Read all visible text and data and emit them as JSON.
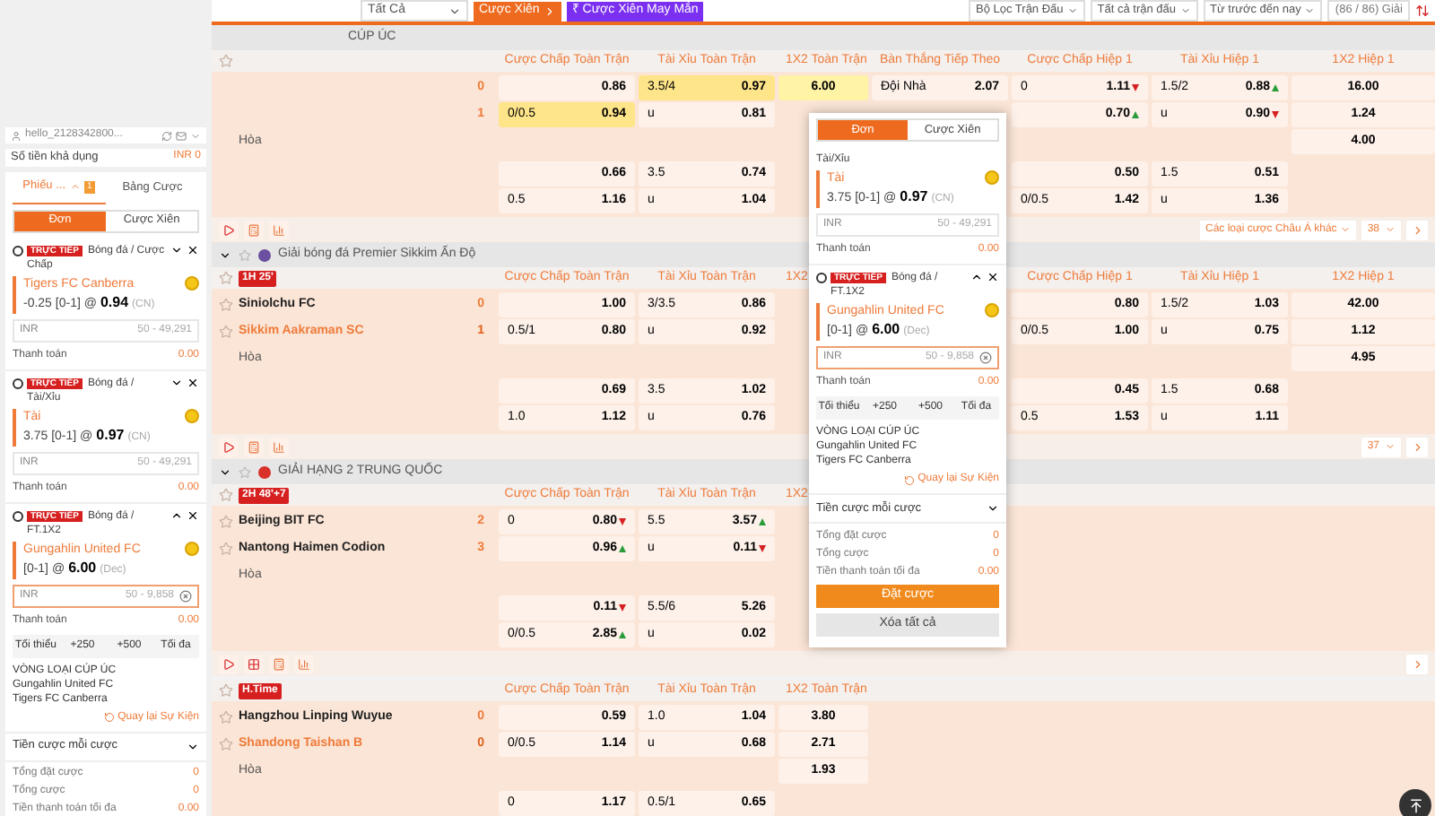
{
  "top_bar": {
    "filter": "Tất Cả",
    "parlay_button": "Cược Xiên",
    "lucky_button": "Cược Xiên May Mắn",
    "lucky_symbol": "₹",
    "dropdowns": [
      "Bộ Lọc Trận Đấu",
      "Tất cả trận đấu",
      "Từ trước đến nay"
    ],
    "league_count": "(86 / 86) Giải"
  },
  "leagues": [
    {
      "name": "CÚP ÚC",
      "matches": [
        {
          "columns": [
            "Cược Chấp Toàn Trận",
            "Tài Xỉu Toàn Trận",
            "1X2 Toàn Trận",
            "Bàn Thắng Tiếp Theo",
            "Cược Chấp Hiệp 1",
            "Tài Xỉu Hiệp 1",
            "1X2 Hiệp 1"
          ],
          "rows": [
            {
              "kind": "team",
              "score": "0",
              "highlighted": false,
              "cells": [
                {
                  "kind": "pair",
                  "odds": "0.86",
                  "selected": false
                },
                {
                  "kind": "pair",
                  "line": "3.5/4",
                  "odds": "0.97",
                  "selected": true
                },
                {
                  "kind": "single",
                  "odds": "6.00",
                  "selected": true
                },
                {
                  "kind": "pair",
                  "line": "Đội Nhà",
                  "odds": "2.07",
                  "selected": false
                },
                {
                  "kind": "pair",
                  "line": "0",
                  "odds": "1.11",
                  "rising": false,
                  "selected": false
                },
                {
                  "kind": "pair",
                  "line": "1.5/2",
                  "odds": "0.88",
                  "rising": true,
                  "selected": false
                },
                {
                  "kind": "single",
                  "odds": "16.00",
                  "selected": false
                }
              ]
            },
            {
              "kind": "team",
              "score": "1",
              "highlighted": false,
              "cells": [
                {
                  "kind": "pair",
                  "line": "0/0.5",
                  "odds": "0.94",
                  "selected": true
                },
                {
                  "kind": "pair",
                  "line": "u",
                  "odds": "0.81",
                  "selected": false
                },
                null,
                null,
                {
                  "kind": "pair",
                  "odds": "0.70",
                  "rising": true,
                  "selected": false
                },
                {
                  "kind": "pair",
                  "line": "u",
                  "odds": "0.90",
                  "rising": false,
                  "selected": false
                },
                {
                  "kind": "single",
                  "odds": "1.24",
                  "selected": false
                }
              ]
            },
            {
              "kind": "draw",
              "team": "Hòa",
              "cells": [
                null,
                null,
                null,
                null,
                null,
                null,
                {
                  "kind": "single",
                  "odds": "4.00",
                  "selected": false
                }
              ]
            },
            {
              "kind": "line",
              "cells": [
                {
                  "kind": "pair",
                  "odds": "0.66",
                  "selected": false
                },
                {
                  "kind": "pair",
                  "line": "3.5",
                  "odds": "0.74",
                  "selected": false
                },
                null,
                null,
                {
                  "kind": "pair",
                  "odds": "0.50",
                  "selected": false
                },
                {
                  "kind": "pair",
                  "line": "1.5",
                  "odds": "0.51",
                  "selected": false
                },
                null
              ]
            },
            {
              "kind": "line",
              "cells": [
                {
                  "kind": "pair",
                  "line": "0.5",
                  "odds": "1.16",
                  "selected": false
                },
                {
                  "kind": "pair",
                  "line": "u",
                  "odds": "1.04",
                  "selected": false
                },
                null,
                null,
                {
                  "kind": "pair",
                  "line": "0/0.5",
                  "odds": "1.42",
                  "selected": false
                },
                {
                  "kind": "pair",
                  "line": "u",
                  "odds": "1.36",
                  "selected": false
                },
                null
              ]
            }
          ],
          "footer": {
            "tools": [
              {
                "kind": "play"
              },
              {
                "kind": "calc"
              },
              {
                "kind": "stats"
              }
            ],
            "more": "Các loại cược Châu Á khác",
            "page": "38"
          }
        }
      ]
    },
    {
      "name": "Giải bóng đá Premier Sikkim Ấn Độ",
      "expanded": true,
      "color": "#6b4fa0",
      "matches": [
        {
          "time": "1H 25'",
          "columns": [
            "Cược Chấp Toàn Trận",
            "Tài Xỉu Toàn Trận",
            "1X2",
            null,
            "Cược Chấp Hiệp 1",
            "Tài Xỉu Hiệp 1",
            "1X2 Hiệp 1"
          ],
          "rows": [
            {
              "kind": "team",
              "team": "Siniolchu FC",
              "score": "0",
              "highlighted": false,
              "cells": [
                {
                  "kind": "pair",
                  "odds": "1.00",
                  "selected": false
                },
                {
                  "kind": "pair",
                  "line": "3/3.5",
                  "odds": "0.86",
                  "selected": false
                },
                null,
                null,
                {
                  "kind": "pair",
                  "odds": "0.80",
                  "selected": false
                },
                {
                  "kind": "pair",
                  "line": "1.5/2",
                  "odds": "1.03",
                  "selected": false
                },
                {
                  "kind": "single",
                  "odds": "42.00",
                  "selected": false
                }
              ]
            },
            {
              "kind": "team",
              "team": "Sikkim Aakraman SC",
              "score": "1",
              "highlighted": true,
              "cells": [
                {
                  "kind": "pair",
                  "line": "0.5/1",
                  "odds": "0.80",
                  "selected": false
                },
                {
                  "kind": "pair",
                  "line": "u",
                  "odds": "0.92",
                  "selected": false
                },
                null,
                null,
                {
                  "kind": "pair",
                  "line": "0/0.5",
                  "odds": "1.00",
                  "selected": false
                },
                {
                  "kind": "pair",
                  "line": "u",
                  "odds": "0.75",
                  "selected": false
                },
                {
                  "kind": "single",
                  "odds": "1.12",
                  "selected": false
                }
              ]
            },
            {
              "kind": "draw",
              "team": "Hòa",
              "cells": [
                null,
                null,
                null,
                null,
                null,
                null,
                {
                  "kind": "single",
                  "odds": "4.95",
                  "selected": false
                }
              ]
            },
            {
              "kind": "line",
              "cells": [
                {
                  "kind": "pair",
                  "odds": "0.69",
                  "selected": false
                },
                {
                  "kind": "pair",
                  "line": "3.5",
                  "odds": "1.02",
                  "selected": false
                },
                null,
                null,
                {
                  "kind": "pair",
                  "odds": "0.45",
                  "selected": false
                },
                {
                  "kind": "pair",
                  "line": "1.5",
                  "odds": "0.68",
                  "selected": false
                },
                null
              ]
            },
            {
              "kind": "line",
              "cells": [
                {
                  "kind": "pair",
                  "line": "1.0",
                  "odds": "1.12",
                  "selected": false
                },
                {
                  "kind": "pair",
                  "line": "u",
                  "odds": "0.76",
                  "selected": false
                },
                null,
                null,
                {
                  "kind": "pair",
                  "line": "0.5",
                  "odds": "1.53",
                  "selected": false
                },
                {
                  "kind": "pair",
                  "line": "u",
                  "odds": "1.11",
                  "selected": false
                },
                null
              ]
            }
          ],
          "footer": {
            "tools": [
              {
                "kind": "play"
              },
              {
                "kind": "calc"
              },
              {
                "kind": "stats"
              }
            ],
            "page": "37"
          }
        }
      ]
    },
    {
      "name": "GIẢI HẠNG 2 TRUNG QUỐC",
      "expanded": true,
      "color": "#d9302a",
      "matches": [
        {
          "time": "2H 48'+7",
          "columns": [
            "Cược Chấp Toàn Trận",
            "Tài Xỉu Toàn Trận",
            "1X2"
          ],
          "rows": [
            {
              "kind": "team",
              "team": "Beijing BIT FC",
              "score": "2",
              "highlighted": false,
              "cells": [
                {
                  "kind": "pair",
                  "line": "0",
                  "odds": "0.80",
                  "rising": false,
                  "selected": false
                },
                {
                  "kind": "pair",
                  "line": "5.5",
                  "odds": "3.57",
                  "rising": true,
                  "selected": false
                }
              ]
            },
            {
              "kind": "team",
              "team": "Nantong Haimen Codion",
              "score": "3",
              "highlighted": false,
              "cells": [
                {
                  "kind": "pair",
                  "odds": "0.96",
                  "rising": true,
                  "selected": false
                },
                {
                  "kind": "pair",
                  "line": "u",
                  "odds": "0.11",
                  "rising": false,
                  "selected": false
                }
              ]
            },
            {
              "kind": "draw",
              "team": "Hòa",
              "cells": [
                null,
                null
              ]
            },
            {
              "kind": "line",
              "cells": [
                {
                  "kind": "pair",
                  "odds": "0.11",
                  "rising": false,
                  "selected": false
                },
                {
                  "kind": "pair",
                  "line": "5.5/6",
                  "odds": "5.26",
                  "selected": false
                }
              ]
            },
            {
              "kind": "line",
              "cells": [
                {
                  "kind": "pair",
                  "line": "0/0.5",
                  "odds": "2.85",
                  "rising": true,
                  "selected": false
                },
                {
                  "kind": "pair",
                  "line": "u",
                  "odds": "0.02",
                  "selected": false
                }
              ]
            }
          ],
          "footer": {
            "tools": [
              {
                "kind": "play"
              },
              {
                "kind": "grid"
              },
              {
                "kind": "calc"
              },
              {
                "kind": "stats"
              }
            ]
          }
        },
        {
          "time": "H.Time",
          "columns": [
            "Cược Chấp Toàn Trận",
            "Tài Xỉu Toàn Trận",
            "1X2 Toàn Trận"
          ],
          "rows": [
            {
              "kind": "team",
              "team": "Hangzhou Linping Wuyue",
              "score": "0",
              "highlighted": false,
              "cells": [
                {
                  "kind": "pair",
                  "odds": "0.59",
                  "selected": false
                },
                {
                  "kind": "pair",
                  "line": "1.0",
                  "odds": "1.04",
                  "selected": false
                },
                {
                  "kind": "single",
                  "odds": "3.80",
                  "selected": false
                }
              ]
            },
            {
              "kind": "team",
              "team": "Shandong Taishan B",
              "score": "0",
              "highlighted": true,
              "cells": [
                {
                  "kind": "pair",
                  "line": "0/0.5",
                  "odds": "1.14",
                  "selected": false
                },
                {
                  "kind": "pair",
                  "line": "u",
                  "odds": "0.68",
                  "selected": false
                },
                {
                  "kind": "single",
                  "odds": "2.71",
                  "selected": false
                }
              ]
            },
            {
              "kind": "draw",
              "team": "Hòa",
              "cells": [
                null,
                null,
                {
                  "kind": "single",
                  "odds": "1.93",
                  "selected": false
                }
              ]
            },
            {
              "kind": "line",
              "cells": [
                {
                  "kind": "pair",
                  "line": "0",
                  "odds": "1.17",
                  "selected": false
                },
                {
                  "kind": "pair",
                  "line": "0.5/1",
                  "odds": "0.65",
                  "selected": false
                },
                null
              ]
            }
          ]
        }
      ]
    }
  ],
  "bet_slip": {
    "username": "hello_2128342800...",
    "balance": {
      "label": "Số tiền khả dụng",
      "value": "INR 0"
    },
    "tabs": [
      {
        "label": "Phiếu ...",
        "badge": "1",
        "selected": true
      },
      {
        "label": "Bảng Cược",
        "selected": false
      }
    ],
    "modes": [
      {
        "label": "Đơn",
        "selected": true
      },
      {
        "label": "Cược Xiên",
        "selected": false
      }
    ],
    "bets": [
      {
        "live_badge": "TRỰC TIẾP",
        "category": "Bóng đá / Cược Chấp",
        "selection": "Tigers FC Canberra",
        "line": "-0.25 [0-1] @",
        "odds": "0.94",
        "format": "(CN)",
        "currency": "INR",
        "placeholder": "50 - 49,291",
        "payout_label": "Thanh toán",
        "payout": "0.00",
        "expanded": false
      },
      {
        "live_badge": "TRỰC TIẾP",
        "category": "Bóng đá / Tài/Xỉu",
        "selection": "Tài",
        "line": "3.75 [0-1] @",
        "odds": "0.97",
        "format": "(CN)",
        "currency": "INR",
        "placeholder": "50 - 49,291",
        "payout_label": "Thanh toán",
        "payout": "0.00",
        "expanded": false
      },
      {
        "live_badge": "TRỰC TIẾP",
        "category": "Bóng đá / FT.1X2",
        "selection": "Gungahlin United FC",
        "line": "[0-1] @",
        "odds": "6.00",
        "format": "(Dec)",
        "currency": "INR",
        "placeholder": "50 - 9,858",
        "payout_label": "Thanh toán",
        "payout": "0.00",
        "expanded": true,
        "quick_amounts": [
          "Tối thiểu",
          "+250",
          "+500",
          "Tối đa"
        ],
        "event": [
          "VÒNG LOẠI CÚP ÚC",
          "Gungahlin United FC",
          "Tigers FC Canberra"
        ],
        "back_link": "Quay lại Sự Kiện"
      }
    ],
    "stake_option": "Tiền cược mỗi cược",
    "totals": [
      {
        "label": "Tổng đặt cược",
        "value": "0"
      },
      {
        "label": "Tổng cược",
        "value": "0"
      },
      {
        "label": "Tiền thanh toán tối đa",
        "value": "0.00"
      }
    ]
  },
  "bet_slip_popup": {
    "modes": [
      {
        "label": "Đơn",
        "selected": true
      },
      {
        "label": "Cược Xiên",
        "selected": false
      }
    ],
    "bets": [
      {
        "category": "Tài/Xỉu",
        "selection": "Tài",
        "line": "3.75 [0-1] @",
        "odds": "0.97",
        "format": "(CN)",
        "currency": "INR",
        "placeholder": "50 - 49,291",
        "payout_label": "Thanh toán",
        "payout": "0.00",
        "expanded": false
      },
      {
        "live_badge": "TRỰC TIẾP",
        "category": "Bóng đá / FT.1X2",
        "selection": "Gungahlin United FC",
        "line": "[0-1] @",
        "odds": "6.00",
        "format": "(Dec)",
        "currency": "INR",
        "placeholder": "50 - 9,858",
        "payout_label": "Thanh toán",
        "payout": "0.00",
        "expanded": true,
        "quick_amounts": [
          "Tối thiểu",
          "+250",
          "+500",
          "Tối đa"
        ],
        "event": [
          "VÒNG LOẠI CÚP ÚC",
          "Gungahlin United FC",
          "Tigers FC Canberra"
        ],
        "back_link": "Quay lại Sự Kiện"
      }
    ],
    "stake_option": "Tiền cược mỗi cược",
    "totals": [
      {
        "label": "Tổng đặt cược",
        "value": "0"
      },
      {
        "label": "Tổng cược",
        "value": "0"
      },
      {
        "label": "Tiền thanh toán tối đa",
        "value": "0.00"
      }
    ],
    "place_button": "Đặt cược",
    "clear_button": "Xóa tất cả"
  }
}
